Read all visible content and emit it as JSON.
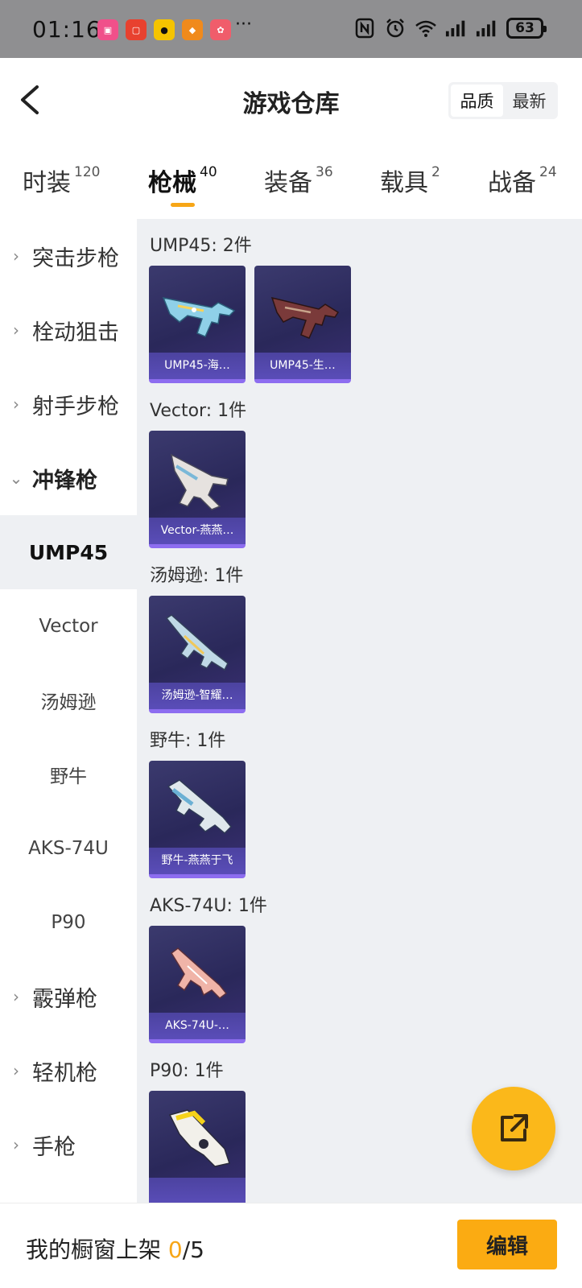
{
  "status_bar": {
    "time": "01:16",
    "more": "···",
    "battery": "63"
  },
  "header": {
    "title": "游戏仓库",
    "sort_options": [
      "品质",
      "最新"
    ]
  },
  "tabs": [
    {
      "label": "时装",
      "count": "120"
    },
    {
      "label": "枪械",
      "count": "40"
    },
    {
      "label": "装备",
      "count": "36"
    },
    {
      "label": "载具",
      "count": "2"
    },
    {
      "label": "战备",
      "count": "24"
    }
  ],
  "sidebar": {
    "categories": [
      "突击步枪",
      "栓动狙击",
      "射手步枪",
      "冲锋枪",
      "霰弹枪",
      "轻机枪",
      "手枪"
    ],
    "subcategories": [
      "UMP45",
      "Vector",
      "汤姆逊",
      "野牛",
      "AKS-74U",
      "P90"
    ]
  },
  "groups": [
    {
      "title": "UMP45: 2件",
      "items": [
        "UMP45-海…",
        "UMP45-生…"
      ]
    },
    {
      "title": "Vector: 1件",
      "items": [
        "Vector-燕燕…"
      ]
    },
    {
      "title": "汤姆逊: 1件",
      "items": [
        "汤姆逊-智耀…"
      ]
    },
    {
      "title": "野牛: 1件",
      "items": [
        "野牛-燕燕于飞"
      ]
    },
    {
      "title": "AKS-74U: 1件",
      "items": [
        "AKS-74U-…"
      ]
    },
    {
      "title": "P90: 1件",
      "items": [
        ""
      ]
    }
  ],
  "bottom_bar": {
    "label": "我的橱窗上架",
    "listed": "0",
    "total": "/5",
    "edit_label": "编辑"
  },
  "colors": {
    "accent": "#f7a616",
    "card_bg": "#2a285a",
    "card_label": "#5a4db8",
    "content_bg": "#eef0f3"
  }
}
